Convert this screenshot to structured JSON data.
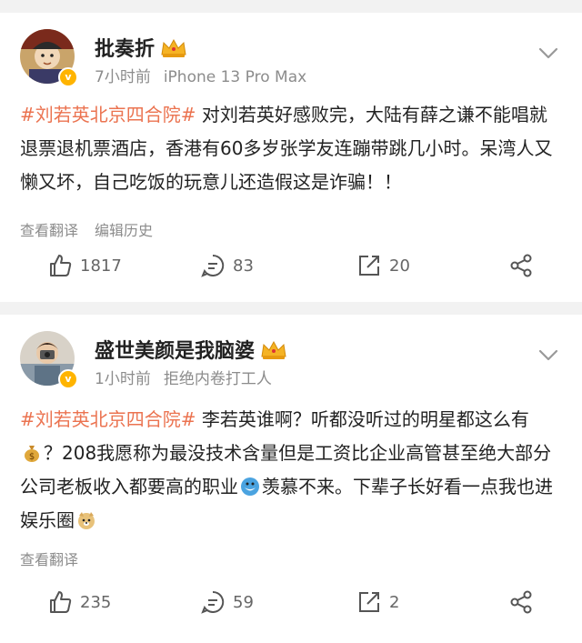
{
  "posts": [
    {
      "author": "批奏折",
      "time": "7小时前",
      "source": "iPhone 13 Pro Max",
      "hashtag": "#刘若英北京四合院#",
      "body": " 对刘若英好感败完，大陆有薛之谦不能唱就退票退机票酒店，香港有60多岁张学友连蹦带跳几小时。呆湾人又懒又坏，自己吃饭的玩意儿还造假这是诈骗！！",
      "note_translate": "查看翻译",
      "note_history": "编辑历史",
      "likes": "1817",
      "comments": "83",
      "reposts": "20"
    },
    {
      "author": "盛世美颜是我脑婆",
      "time": "1小时前",
      "source": "拒绝内卷打工人",
      "hashtag": "#刘若英北京四合院#",
      "body_a": " 李若英谁啊？听都没听过的明星都这么有",
      "body_b": "？208我愿称为最没技术含量但是工资比企业高管甚至绝大部分公司老板收入都要高的职业",
      "body_c": "羡慕不来。下辈子长好看一点我也进娱乐圈",
      "note_translate": "查看翻译",
      "likes": "235",
      "comments": "59",
      "reposts": "2"
    }
  ],
  "icons": [
    "crown-icon",
    "verified-v-icon",
    "chevron-down-icon",
    "thumb-up-icon",
    "comment-icon",
    "repost-icon",
    "share-icon",
    "money-bag-emoji",
    "dolphin-emoji",
    "doge-emoji"
  ],
  "colors": {
    "hashtag": "#eb7350",
    "verified": "#ffb400",
    "meta": "#8c8c8c"
  }
}
